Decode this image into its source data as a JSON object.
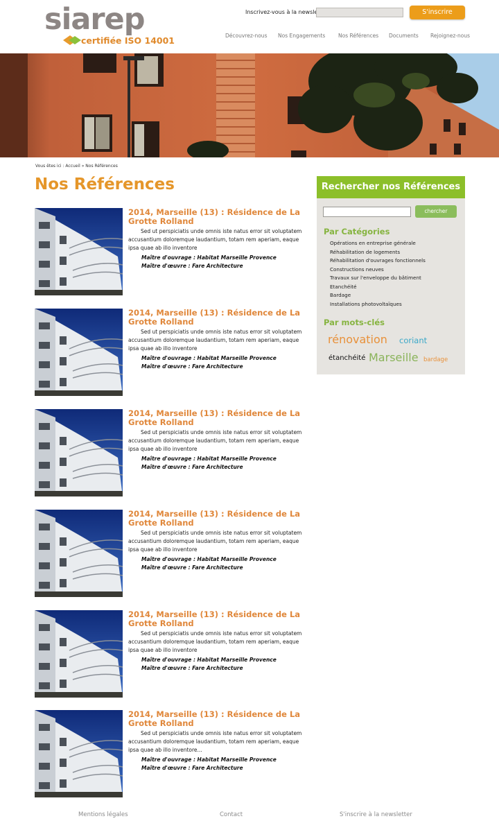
{
  "header": {
    "logo_text": "siarep",
    "logo_cert": "certifiée ISO 14001",
    "newsletter_label": "Inscrivez-vous à la newsletter",
    "newsletter_value": "",
    "subscribe_label": "S'inscrire",
    "nav": [
      "Découvrez-nous",
      "Nos Engagements",
      "Nos Références",
      "Documents",
      "Rejoignez-nous"
    ]
  },
  "breadcrumb": "Vous êtes ici : Accueil » Nos Références",
  "page_title": "Nos Références",
  "articles": [
    {
      "title": "2014, Marseille (13) : Résidence de La Grotte Rolland",
      "text": "Sed ut perspiciatis unde omnis iste natus error sit voluptatem accusantium doloremque laudantium, totam rem aperiam, eaque ipsa quae ab illo inventore",
      "maitre_ouvrage": "Maître d'ouvrage : Habitat Marseille Provence",
      "maitre_oeuvre": "Maître d'œuvre : Fare Architecture"
    },
    {
      "title": "2014, Marseille (13) : Résidence de La Grotte Rolland",
      "text": "Sed ut perspiciatis unde omnis iste natus error sit voluptatem accusantium doloremque laudantium, totam rem aperiam, eaque ipsa quae ab illo inventore",
      "maitre_ouvrage": "Maître d'ouvrage : Habitat Marseille Provence",
      "maitre_oeuvre": "Maître d'œuvre : Fare Architecture"
    },
    {
      "title": "2014, Marseille (13) : Résidence de La Grotte Rolland",
      "text": "Sed ut perspiciatis unde omnis iste natus error sit voluptatem accusantium doloremque laudantium, totam rem aperiam, eaque ipsa quae ab illo inventore",
      "maitre_ouvrage": "Maître d'ouvrage : Habitat Marseille Provence",
      "maitre_oeuvre": "Maître d'œuvre : Fare Architecture"
    },
    {
      "title": "2014, Marseille (13) : Résidence de La Grotte Rolland",
      "text": "Sed ut perspiciatis unde omnis iste natus error sit voluptatem accusantium doloremque laudantium, totam rem aperiam, eaque ipsa quae ab illo inventore",
      "maitre_ouvrage": "Maître d'ouvrage : Habitat Marseille Provence",
      "maitre_oeuvre": "Maître d'œuvre : Fare Architecture"
    },
    {
      "title": "2014, Marseille (13) : Résidence de La Grotte Rolland",
      "text": "Sed ut perspiciatis unde omnis iste natus error sit voluptatem accusantium doloremque laudantium, totam rem aperiam, eaque ipsa quae ab illo inventore",
      "maitre_ouvrage": "Maître d'ouvrage : Habitat Marseille Provence",
      "maitre_oeuvre": "Maître d'œuvre : Fare Architecture"
    },
    {
      "title": "2014, Marseille (13) : Résidence de La Grotte Rolland",
      "text": "Sed ut perspiciatis unde omnis iste natus error sit voluptatem accusantium doloremque laudantium, totam rem aperiam, eaque ipsa quae ab illo inventore...",
      "maitre_ouvrage": "Maître d'ouvrage : Habitat Marseille Provence",
      "maitre_oeuvre": "Maître d'œuvre : Fare Architecture"
    }
  ],
  "sidebar": {
    "title": "Rechercher nos Références",
    "search_value": "",
    "search_button": "chercher",
    "categories_title": "Par Catégories",
    "categories": [
      "Opérations en entreprise générale",
      "Réhabilitation de logements",
      "Réhabilitation d'ouvrages fonctionnels",
      "Constructions neuves",
      "Travaux sur l'enveloppe du bâtiment",
      "Etanchéité",
      "Bardage",
      "Installations photovoltaïques"
    ],
    "tags_title": "Par mots-clés",
    "tags": [
      "rénovation",
      "coriant",
      "étanchéité",
      "Marseille",
      "bardage"
    ]
  },
  "footer": {
    "links": [
      "Mentions légales",
      "Contact",
      "S'inscrire à la newsletter"
    ]
  },
  "colors": {
    "orange": "#e5962a",
    "green": "#8cbf2a",
    "button_orange": "#ec9d1a",
    "sidebar_bg": "#e6e4e0"
  }
}
